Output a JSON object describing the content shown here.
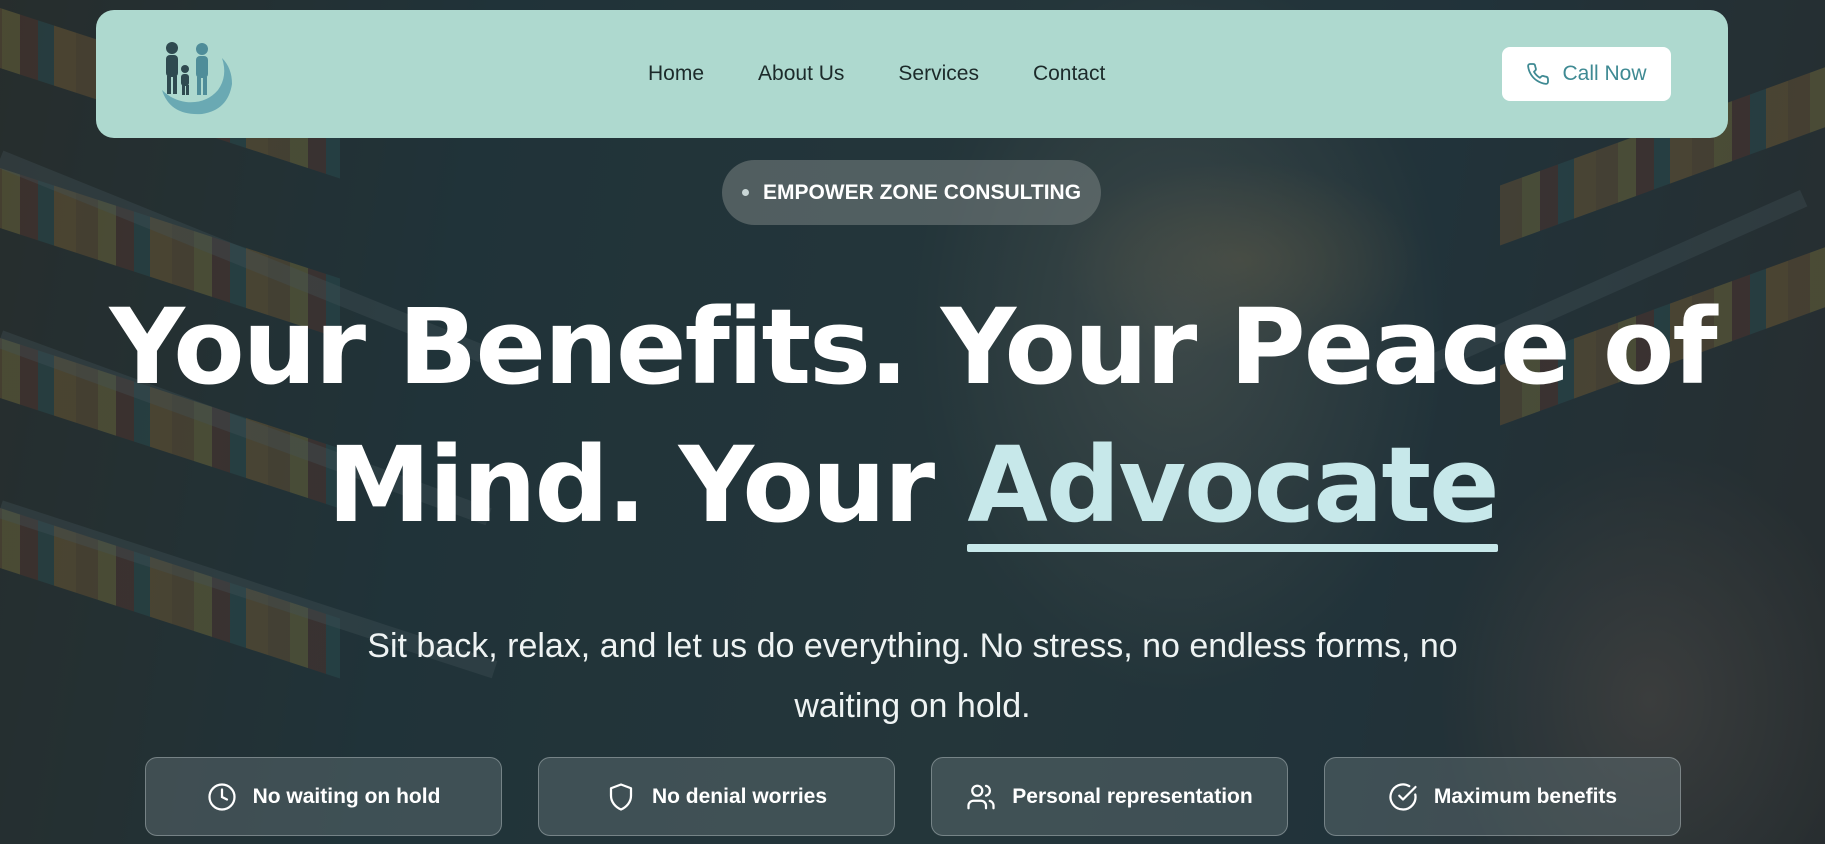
{
  "nav": {
    "menu": [
      "Home",
      "About Us",
      "Services",
      "Contact"
    ],
    "call_label": "Call Now",
    "logo_icon": "family-hand-logo",
    "phone_icon": "phone-icon"
  },
  "badge": {
    "text": "EMPOWER ZONE CONSULTING"
  },
  "hero": {
    "line1": "Your Benefits. Your Peace of",
    "line2_plain": "Mind. Your ",
    "line2_accent": "Advocate",
    "subtitle": "Sit back, relax, and let us do everything. No stress, no endless forms, no waiting on hold."
  },
  "features": [
    {
      "label": "No waiting on hold",
      "icon": "clock-icon"
    },
    {
      "label": "No denial worries",
      "icon": "shield-icon"
    },
    {
      "label": "Personal representation",
      "icon": "users-icon"
    },
    {
      "label": "Maximum benefits",
      "icon": "check-circle-icon"
    }
  ],
  "colors": {
    "nav_bg": "#aed9cf",
    "accent": "#c7e8ea",
    "button_text": "#3f8a93"
  }
}
